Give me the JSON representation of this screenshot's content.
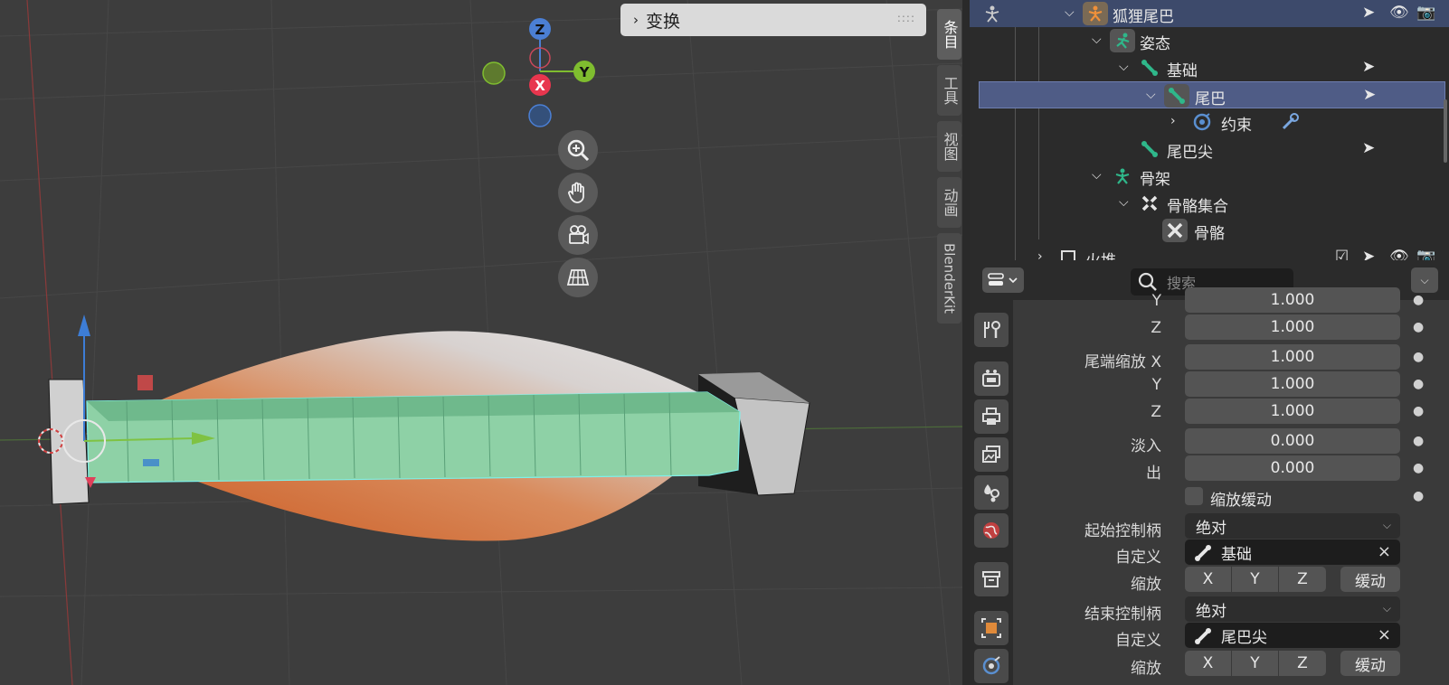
{
  "viewport": {
    "transform_panel": "变换",
    "gizmo": {
      "z": "Z",
      "y": "Y",
      "x": "X"
    },
    "side_tabs": [
      "条目",
      "工具",
      "视图",
      "动画",
      "BlenderKit"
    ]
  },
  "outliner": {
    "rows": [
      {
        "label": "狐狸尾巴"
      },
      {
        "label": "姿态"
      },
      {
        "label": "基础"
      },
      {
        "label": "尾巴"
      },
      {
        "label": "约束"
      },
      {
        "label": "尾巴尖"
      },
      {
        "label": "骨架"
      },
      {
        "label": "骨骼集合"
      },
      {
        "label": "骨骼"
      },
      {
        "label": "火堆"
      }
    ]
  },
  "properties": {
    "search_placeholder": "搜索",
    "rows": {
      "y_top": {
        "label": "Y",
        "value": "1.000"
      },
      "z1": {
        "label": "Z",
        "value": "1.000"
      },
      "scale_out_x": {
        "label": "尾端缩放 X",
        "value": "1.000"
      },
      "y2": {
        "label": "Y",
        "value": "1.000"
      },
      "z2": {
        "label": "Z",
        "value": "1.000"
      },
      "ease_in": {
        "label": "淡入",
        "value": "0.000"
      },
      "ease_out": {
        "label": "出",
        "value": "0.000"
      },
      "scale_easing": {
        "label": "缩放缓动"
      },
      "start_handle": {
        "label": "起始控制柄",
        "value": "绝对"
      },
      "start_custom": {
        "label": "自定义",
        "value": "基础"
      },
      "start_scale": {
        "label": "缩放",
        "x": "X",
        "y": "Y",
        "z": "Z",
        "ease": "缓动"
      },
      "end_handle": {
        "label": "结束控制柄",
        "value": "绝对"
      },
      "end_custom": {
        "label": "自定义",
        "value": "尾巴尖"
      },
      "end_scale": {
        "label": "缩放",
        "x": "X",
        "y": "Y",
        "z": "Z",
        "ease": "缓动"
      }
    }
  }
}
